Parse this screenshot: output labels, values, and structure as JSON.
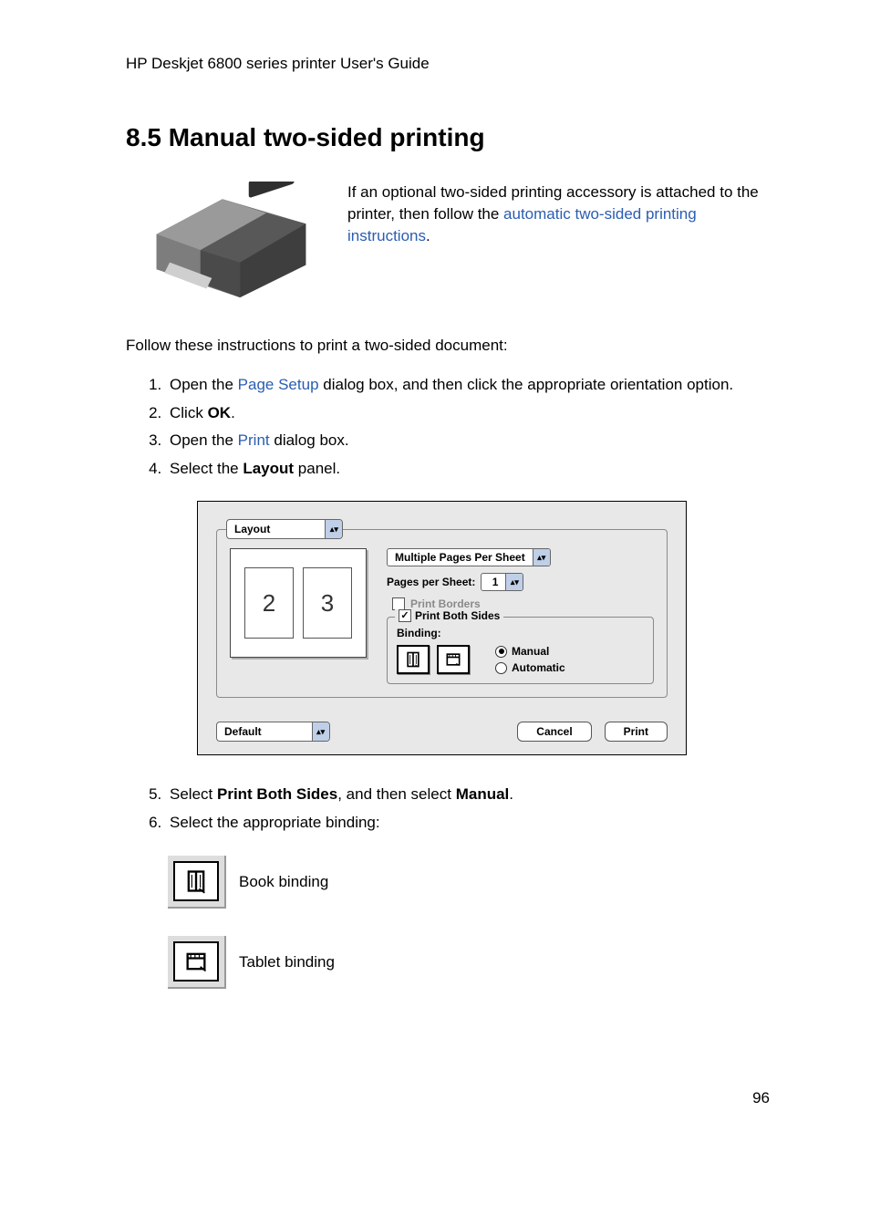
{
  "header": "HP Deskjet 6800 series printer User's Guide",
  "heading": "8.5  Manual two-sided printing",
  "intro": {
    "text_a": "If an optional two-sided printing accessory is attached to the printer, then follow the ",
    "link": "automatic two-sided printing instructions",
    "text_b": "."
  },
  "follow": "Follow these instructions to print a two-sided document:",
  "steps": {
    "s1a": "Open the ",
    "s1link": "Page Setup",
    "s1b": " dialog box, and then click the appropriate orientation option.",
    "s2a": "Click ",
    "s2bold": "OK",
    "s2b": ".",
    "s3a": "Open the ",
    "s3link": "Print",
    "s3b": " dialog box.",
    "s4a": "Select the ",
    "s4bold": "Layout",
    "s4b": " panel.",
    "s5a": "Select ",
    "s5bold1": "Print Both Sides",
    "s5mid": ", and then select ",
    "s5bold2": "Manual",
    "s5b": ".",
    "s6": "Select the appropriate binding:"
  },
  "dialog": {
    "panel_selector": "Layout",
    "multiple_pages": "Multiple Pages Per Sheet",
    "pages_per_sheet_label": "Pages per Sheet:",
    "pages_per_sheet_value": "1",
    "print_borders": "Print Borders",
    "print_both_sides": "Print Both Sides",
    "binding_label": "Binding:",
    "manual": "Manual",
    "automatic": "Automatic",
    "default": "Default",
    "cancel": "Cancel",
    "print": "Print",
    "preview_left": "2",
    "preview_right": "3",
    "check_mark": "✓"
  },
  "binding_rows": {
    "book": "Book binding",
    "tablet": "Tablet binding"
  },
  "page_number": "96"
}
